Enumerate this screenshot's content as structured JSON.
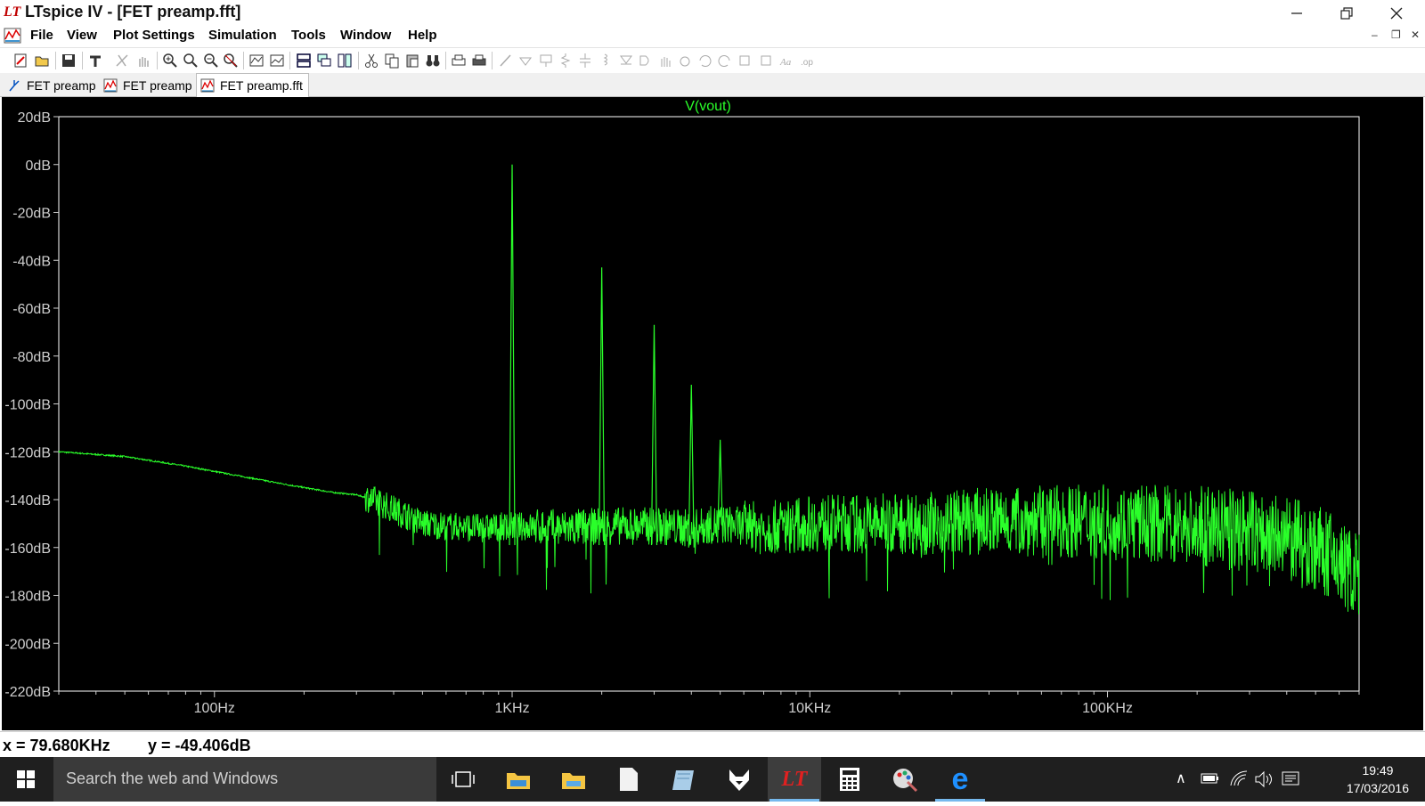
{
  "window": {
    "title": "LTspice IV - [FET preamp.fft]",
    "logo": "LT"
  },
  "menu": [
    "File",
    "View",
    "Plot Settings",
    "Simulation",
    "Tools",
    "Window",
    "Help"
  ],
  "tabs": [
    {
      "label": "FET preamp",
      "icon": "schematic-icon"
    },
    {
      "label": "FET preamp",
      "icon": "waveform-icon"
    },
    {
      "label": "FET preamp.fft",
      "icon": "waveform-icon",
      "active": true
    }
  ],
  "plot": {
    "trace_name": "V(vout)",
    "trace_color": "#2aff2a",
    "axis_color": "#cfcfcf",
    "frame_color": "#ffffff",
    "y_ticks": [
      "20dB",
      "0dB",
      "-20dB",
      "-40dB",
      "-60dB",
      "-80dB",
      "-100dB",
      "-120dB",
      "-140dB",
      "-160dB",
      "-180dB",
      "-200dB",
      "-220dB"
    ],
    "x_ticks": [
      "100Hz",
      "1KHz",
      "10KHz",
      "100KHz"
    ]
  },
  "chart_data": {
    "type": "line",
    "title": "V(vout)",
    "xlabel": "",
    "ylabel": "",
    "x_scale": "log",
    "xlim": [
      30,
      700000
    ],
    "ylim": [
      -220,
      20
    ],
    "x_ticks": [
      100,
      1000,
      10000,
      100000
    ],
    "y_ticks": [
      20,
      0,
      -20,
      -40,
      -60,
      -80,
      -100,
      -120,
      -140,
      -160,
      -180,
      -200,
      -220
    ],
    "grid": false,
    "series": [
      {
        "name": "V(vout)",
        "color": "#2aff2a",
        "x": [
          30,
          50,
          80,
          120,
          180,
          250,
          300,
          340,
          400,
          500,
          600,
          800,
          1000,
          1500,
          2000,
          2500,
          3000,
          4000,
          5000,
          7000,
          10000,
          20000,
          40000,
          80000,
          150000,
          300000,
          500000,
          700000
        ],
        "y": [
          -120,
          -122,
          -126,
          -130,
          -134,
          -137,
          -138,
          -140,
          -144,
          -150,
          -151,
          -152,
          -151,
          -152,
          -151,
          -151,
          -151,
          -152,
          -150,
          -152,
          -150,
          -150,
          -149,
          -149,
          -150,
          -153,
          -160,
          -172
        ]
      }
    ],
    "peaks": [
      {
        "x": 1000,
        "y": 0
      },
      {
        "x": 2000,
        "y": -43
      },
      {
        "x": 3000,
        "y": -67
      },
      {
        "x": 4000,
        "y": -92
      },
      {
        "x": 5000,
        "y": -115
      }
    ]
  },
  "status": {
    "x_label": "x = 79.680KHz",
    "y_label": "y = -49.406dB"
  },
  "taskbar": {
    "search_placeholder": "Search the web and Windows",
    "time": "19:49",
    "date": "17/03/2016"
  },
  "colors": {
    "plot_bg": "#000000",
    "taskbar_bg": "#1f1f1f",
    "accent": "#76b9ed"
  }
}
